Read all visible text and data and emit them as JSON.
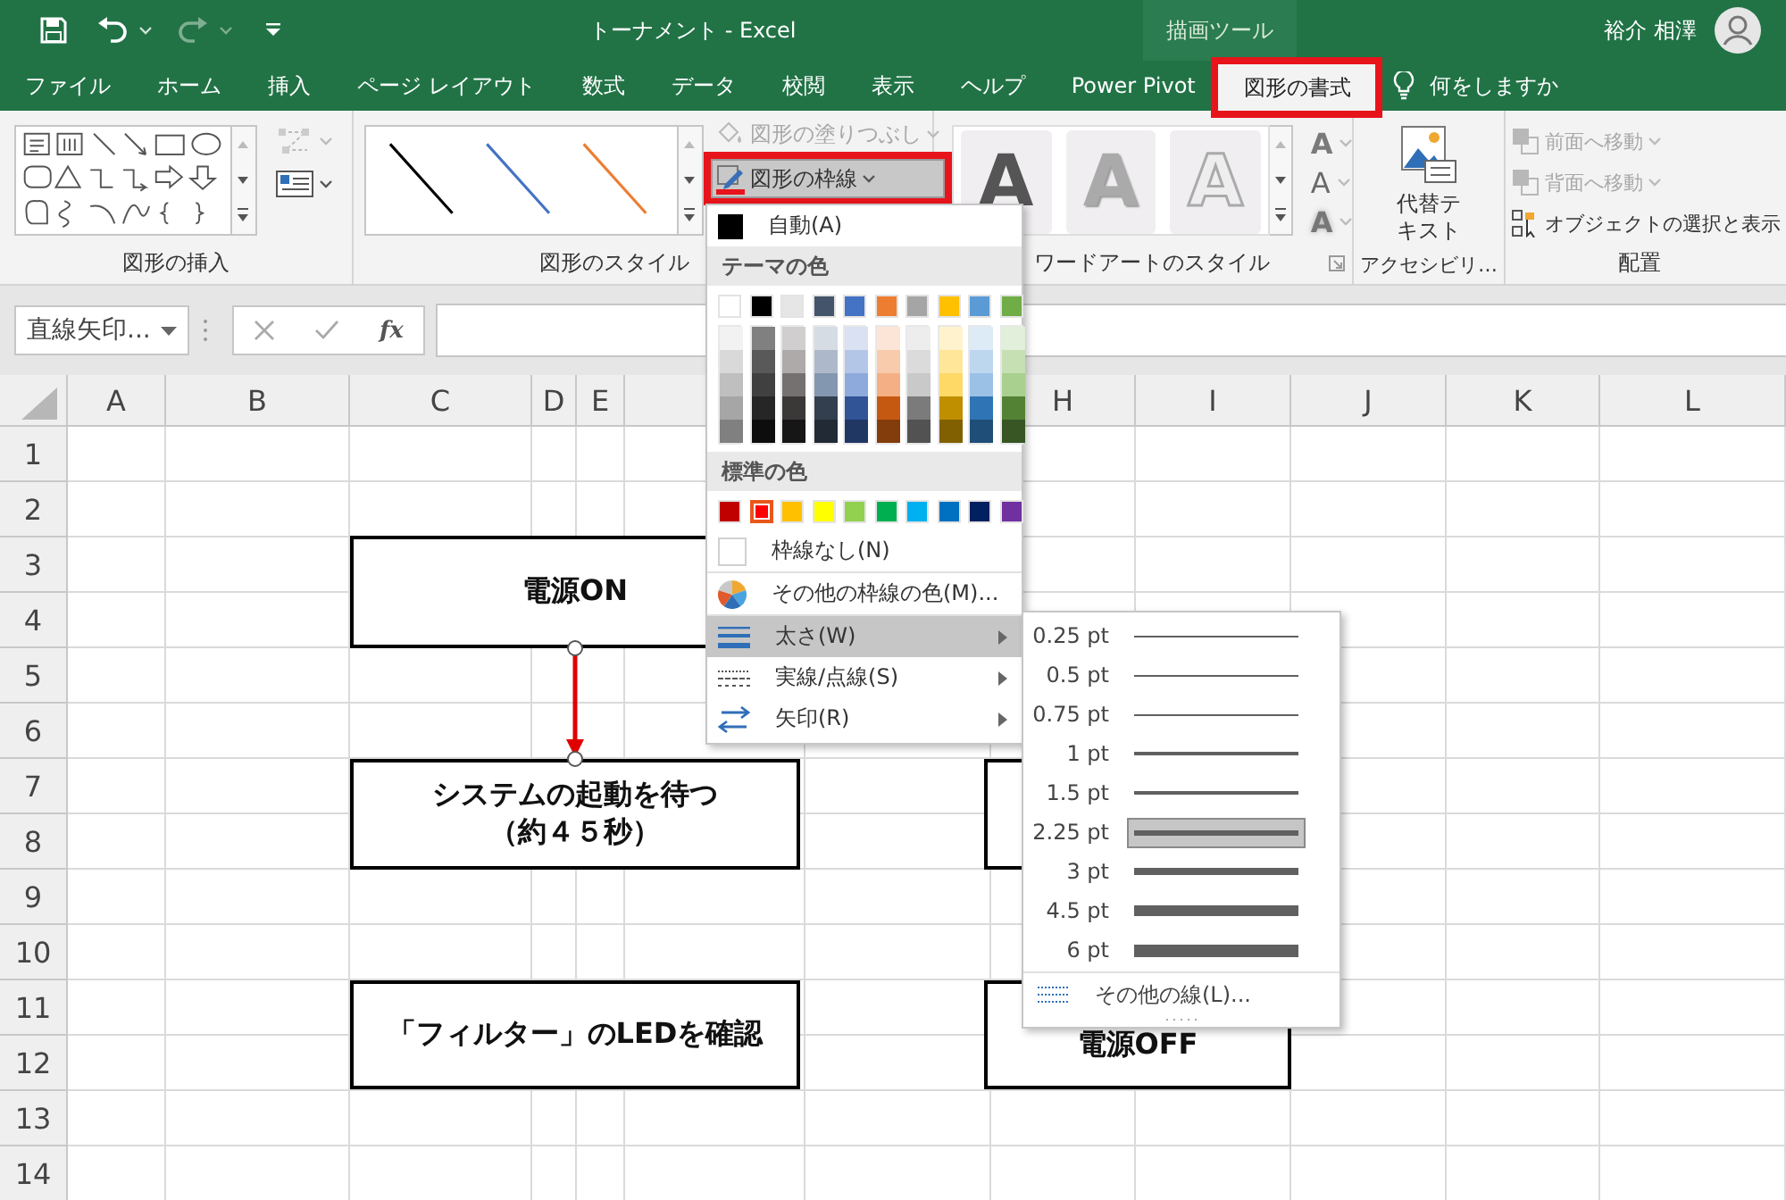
{
  "title_bar": {
    "title": "トーナメント  -  Excel",
    "context_label": "描画ツール",
    "user_name": "裕介 相澤"
  },
  "tabs": [
    {
      "label": "ファイル",
      "selected": false,
      "callout": false
    },
    {
      "label": "ホーム",
      "selected": false,
      "callout": false
    },
    {
      "label": "挿入",
      "selected": false,
      "callout": false
    },
    {
      "label": "ページ レイアウト",
      "selected": false,
      "callout": false
    },
    {
      "label": "数式",
      "selected": false,
      "callout": false
    },
    {
      "label": "データ",
      "selected": false,
      "callout": false
    },
    {
      "label": "校閲",
      "selected": false,
      "callout": false
    },
    {
      "label": "表示",
      "selected": false,
      "callout": false
    },
    {
      "label": "ヘルプ",
      "selected": false,
      "callout": false
    },
    {
      "label": "Power Pivot",
      "selected": false,
      "callout": false
    },
    {
      "label": "図形の書式",
      "selected": true,
      "callout": true
    }
  ],
  "tell_me": {
    "placeholder": "何をしますか"
  },
  "ribbon": {
    "insert_shapes": {
      "label": "図形の挿入"
    },
    "shape_styles": {
      "label": "図形のスタイル",
      "presets": [
        {
          "color": "#000000"
        },
        {
          "color": "#4472c4"
        },
        {
          "color": "#ed7d31"
        }
      ],
      "fill_button": {
        "label": "図形の塗りつぶし",
        "disabled": true
      },
      "outline_button": {
        "label": "図形の枠線",
        "callout": true,
        "expanded": true
      }
    },
    "wordart": {
      "label": "ワードアートのスタイル",
      "presets": [
        {
          "kind": "solid",
          "sample": "A"
        },
        {
          "kind": "light",
          "sample": "A"
        },
        {
          "kind": "outline",
          "sample": "A"
        }
      ],
      "tools": [
        {
          "kind": "fill",
          "glyph": "A"
        },
        {
          "kind": "outline",
          "glyph": "A"
        },
        {
          "kind": "effects",
          "glyph": "A"
        }
      ]
    },
    "accessibility": {
      "label": "アクセシビリ…",
      "button": "代替テキスト"
    },
    "arrange": {
      "label": "配置",
      "items": [
        {
          "kind": "front",
          "label": "前面へ移動",
          "disabled": true
        },
        {
          "kind": "back",
          "label": "背面へ移動",
          "disabled": true
        },
        {
          "kind": "pane",
          "label": "オブジェクトの選択と表示",
          "disabled": false
        }
      ]
    }
  },
  "formula_bar": {
    "name_box": "直線矢印...",
    "function_label": "fx"
  },
  "sheet": {
    "columns": [
      {
        "label": "A"
      },
      {
        "label": "B"
      },
      {
        "label": "C"
      },
      {
        "label": "D"
      },
      {
        "label": "E"
      },
      {
        "label": "H"
      },
      {
        "label": "I"
      },
      {
        "label": "J"
      },
      {
        "label": "K"
      },
      {
        "label": "L"
      }
    ],
    "rows": [
      "1",
      "2",
      "3",
      "4",
      "5",
      "6",
      "7",
      "8",
      "9",
      "10",
      "11",
      "12",
      "13",
      "14"
    ],
    "shapes": [
      {
        "kind": "box",
        "lines": [
          "電源ON"
        ]
      },
      {
        "kind": "box",
        "lines": [
          "システムの起動を待つ",
          "（約４５秒）"
        ]
      },
      {
        "kind": "box",
        "lines": [
          "「フィルター」のLEDを確認"
        ]
      },
      {
        "kind": "box"
      },
      {
        "kind": "box",
        "lines": [
          "電源OFF"
        ]
      }
    ],
    "connectors": [
      {
        "kind": "arrow",
        "color": "#e00000",
        "selected": true
      }
    ]
  },
  "outline_menu": {
    "auto": "自動(A)",
    "theme_header": "テーマの色",
    "theme_colors": [
      {
        "color": "#ffffff",
        "shades": [
          {
            "color": "#f2f2f2"
          },
          {
            "color": "#d9d9d9"
          },
          {
            "color": "#bfbfbf"
          },
          {
            "color": "#a6a6a6"
          },
          {
            "color": "#808080"
          }
        ]
      },
      {
        "color": "#000000",
        "shades": [
          {
            "color": "#808080"
          },
          {
            "color": "#595959"
          },
          {
            "color": "#404040"
          },
          {
            "color": "#262626"
          },
          {
            "color": "#0d0d0d"
          }
        ]
      },
      {
        "color": "#e7e6e6",
        "shades": [
          {
            "color": "#d0cece"
          },
          {
            "color": "#aeaaaa"
          },
          {
            "color": "#767171"
          },
          {
            "color": "#3b3838"
          },
          {
            "color": "#171616"
          }
        ]
      },
      {
        "color": "#44546a",
        "shades": [
          {
            "color": "#d6dce4"
          },
          {
            "color": "#adb9ca"
          },
          {
            "color": "#8497b0"
          },
          {
            "color": "#333f4f"
          },
          {
            "color": "#222a35"
          }
        ]
      },
      {
        "color": "#4472c4",
        "shades": [
          {
            "color": "#d9e1f2"
          },
          {
            "color": "#b4c6e7"
          },
          {
            "color": "#8ea9db"
          },
          {
            "color": "#305496"
          },
          {
            "color": "#203764"
          }
        ]
      },
      {
        "color": "#ed7d31",
        "shades": [
          {
            "color": "#fce4d6"
          },
          {
            "color": "#f8cbad"
          },
          {
            "color": "#f4b084"
          },
          {
            "color": "#c65911"
          },
          {
            "color": "#833c0c"
          }
        ]
      },
      {
        "color": "#a5a5a5",
        "shades": [
          {
            "color": "#ededed"
          },
          {
            "color": "#dbdbdb"
          },
          {
            "color": "#c9c9c9"
          },
          {
            "color": "#7b7b7b"
          },
          {
            "color": "#525252"
          }
        ]
      },
      {
        "color": "#ffc000",
        "shades": [
          {
            "color": "#fff2cc"
          },
          {
            "color": "#ffe699"
          },
          {
            "color": "#ffd966"
          },
          {
            "color": "#bf8f00"
          },
          {
            "color": "#806000"
          }
        ]
      },
      {
        "color": "#5b9bd5",
        "shades": [
          {
            "color": "#ddebf7"
          },
          {
            "color": "#bdd7ee"
          },
          {
            "color": "#9bc2e6"
          },
          {
            "color": "#2f75b5"
          },
          {
            "color": "#1f4e78"
          }
        ]
      },
      {
        "color": "#70ad47",
        "shades": [
          {
            "color": "#e2efda"
          },
          {
            "color": "#c6e0b4"
          },
          {
            "color": "#a9d08e"
          },
          {
            "color": "#548235"
          },
          {
            "color": "#375623"
          }
        ]
      }
    ],
    "standard_header": "標準の色",
    "standard_colors": [
      {
        "color": "#c00000",
        "selected": false
      },
      {
        "color": "#ff0000",
        "selected": true
      },
      {
        "color": "#ffc000",
        "selected": false
      },
      {
        "color": "#ffff00",
        "selected": false
      },
      {
        "color": "#92d050",
        "selected": false
      },
      {
        "color": "#00b050",
        "selected": false
      },
      {
        "color": "#00b0f0",
        "selected": false
      },
      {
        "color": "#0070c0",
        "selected": false
      },
      {
        "color": "#002060",
        "selected": false
      },
      {
        "color": "#7030a0",
        "selected": false
      }
    ],
    "items": [
      {
        "kind": "no-outline",
        "label": "枠線なし(N)",
        "selected": false,
        "submenu": false
      },
      {
        "kind": "more-colors",
        "label": "その他の枠線の色(M)...",
        "selected": false,
        "submenu": false
      },
      {
        "kind": "weight",
        "label": "太さ(W)",
        "selected": true,
        "submenu": true
      },
      {
        "kind": "dash",
        "label": "実線/点線(S)",
        "selected": false,
        "submenu": true
      },
      {
        "kind": "arrows",
        "label": "矢印(R)",
        "selected": false,
        "submenu": true
      }
    ]
  },
  "weight_menu": {
    "items": [
      {
        "label": "0.25 pt",
        "selected": false
      },
      {
        "label": "0.5 pt",
        "selected": false
      },
      {
        "label": "0.75 pt",
        "selected": false
      },
      {
        "label": "1 pt",
        "selected": false
      },
      {
        "label": "1.5 pt",
        "selected": false
      },
      {
        "label": "2.25 pt",
        "selected": true
      },
      {
        "label": "3 pt",
        "selected": false
      },
      {
        "label": "4.5 pt",
        "selected": false
      },
      {
        "label": "6 pt",
        "selected": false
      }
    ],
    "more": "その他の線(L)..."
  }
}
